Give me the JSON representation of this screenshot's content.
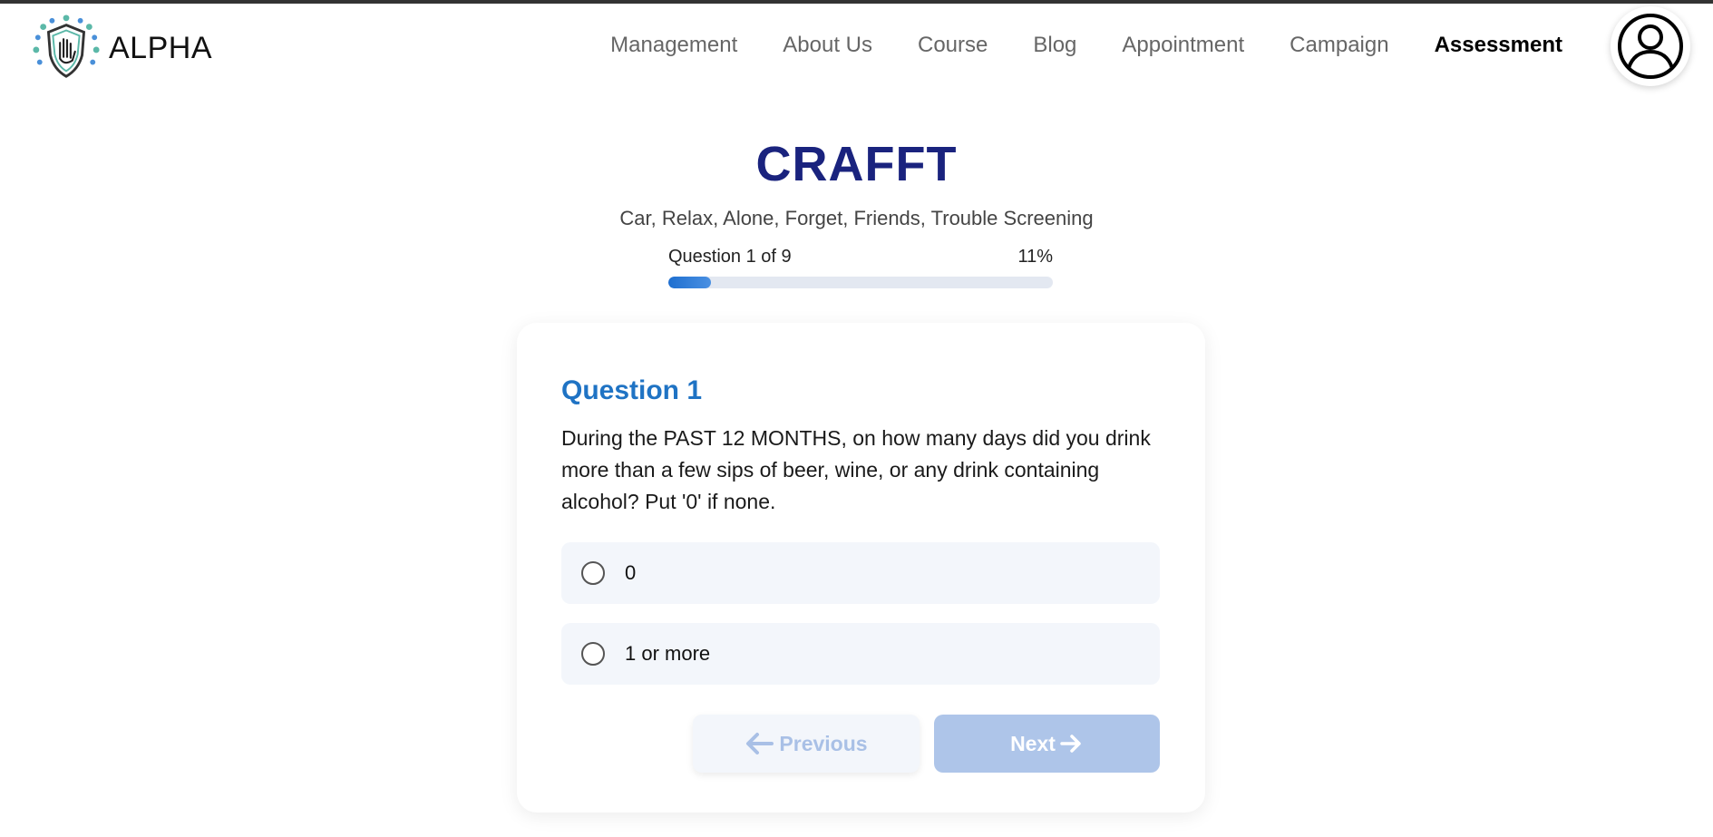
{
  "header": {
    "brand": "ALPHA",
    "nav": [
      {
        "label": "Management"
      },
      {
        "label": "About Us"
      },
      {
        "label": "Course"
      },
      {
        "label": "Blog"
      },
      {
        "label": "Appointment"
      },
      {
        "label": "Campaign"
      },
      {
        "label": "Assessment",
        "active": true
      }
    ]
  },
  "assessment": {
    "title": "CRAFFT",
    "subtitle": "Car, Relax, Alone, Forget, Friends, Trouble Screening",
    "progress": {
      "label": "Question 1 of 9",
      "percent_label": "11%",
      "fraction": 0.11
    }
  },
  "question": {
    "title": "Question 1",
    "text": "During the PAST 12 MONTHS, on how many days did you drink more than a few sips of beer, wine, or any drink containing alcohol? Put '0' if none.",
    "options": [
      {
        "label": "0"
      },
      {
        "label": "1 or more"
      }
    ]
  },
  "buttons": {
    "previous": "Previous",
    "next": "Next"
  },
  "colors": {
    "title": "#1a237e",
    "question_title": "#1f73c4",
    "progress_fill": "#1e6fd0",
    "next_button_bg": "#aec5e9"
  }
}
